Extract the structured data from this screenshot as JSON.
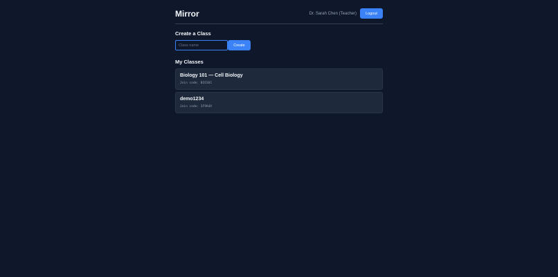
{
  "header": {
    "app_title": "Mirror",
    "user_name": "Dr. Sarah Chen (Teacher)",
    "logout_label": "Logout"
  },
  "create_class": {
    "heading": "Create a Class",
    "input_placeholder": "Class name",
    "input_value": "",
    "create_label": "Create"
  },
  "my_classes": {
    "heading": "My Classes",
    "items": [
      {
        "name": "Biology 101 — Cell Biology",
        "join_code": "Join code: BIO101"
      },
      {
        "name": "demo1234",
        "join_code": "Join code: 3F9A4X"
      }
    ]
  },
  "colors": {
    "background": "#0f172a",
    "card": "#1e293b",
    "accent": "#3b82f6",
    "muted_text": "#94a3b8"
  }
}
